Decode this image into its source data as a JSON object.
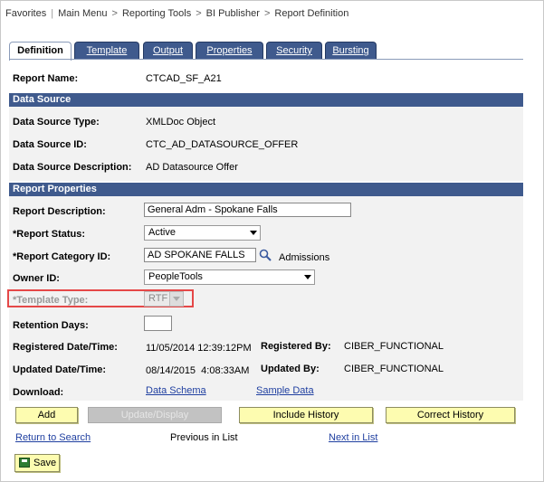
{
  "breadcrumb": {
    "favorites": "Favorites",
    "main_menu": "Main Menu",
    "reporting_tools": "Reporting Tools",
    "bi_publisher": "BI Publisher",
    "report_definition": "Report Definition"
  },
  "tabs": [
    "Definition",
    "Template",
    "Output",
    "Properties",
    "Security",
    "Bursting"
  ],
  "report_name": {
    "label": "Report Name:",
    "value": "CTCAD_SF_A21"
  },
  "data_source": {
    "heading": "Data Source",
    "type_label": "Data Source Type:",
    "type_value": "XMLDoc Object",
    "id_label": "Data Source ID:",
    "id_value": "CTC_AD_DATASOURCE_OFFER",
    "desc_label": "Data Source Description:",
    "desc_value": "AD Datasource Offer"
  },
  "report_properties": {
    "heading": "Report Properties",
    "desc_label": "Report Description:",
    "desc_value": "General Adm - Spokane Falls",
    "status_label": "*Report Status:",
    "status_value": "Active",
    "category_label": "*Report Category ID:",
    "category_value": "AD SPOKANE FALLS",
    "category_desc": "Admissions",
    "owner_label": "Owner ID:",
    "owner_value": "PeopleTools",
    "template_type_label": "*Template Type:",
    "template_type_value": "RTF",
    "retention_label": "Retention Days:",
    "retention_value": "",
    "registered_dt_label": "Registered Date/Time:",
    "registered_dt_value": "11/05/2014 12:39:12PM",
    "registered_by_label": "Registered By:",
    "registered_by_value": "CIBER_FUNCTIONAL",
    "updated_dt_label": "Updated Date/Time:",
    "updated_dt_value": "08/14/2015  4:08:33AM",
    "updated_by_label": "Updated By:",
    "updated_by_value": "CIBER_FUNCTIONAL",
    "download_label": "Download:",
    "data_schema_link": "Data Schema",
    "sample_data_link": "Sample Data"
  },
  "buttons": {
    "add": "Add",
    "update_display": "Update/Display",
    "include_history": "Include History",
    "correct_history": "Correct History",
    "save": "Save"
  },
  "nav": {
    "return_to_search": "Return to Search",
    "previous_in_list": "Previous in List",
    "next_in_list": "Next in List"
  },
  "colors": {
    "band": "#3f5a8d",
    "button": "#fdfcb0",
    "highlight_box": "#e54848",
    "link": "#1f3fa0"
  }
}
